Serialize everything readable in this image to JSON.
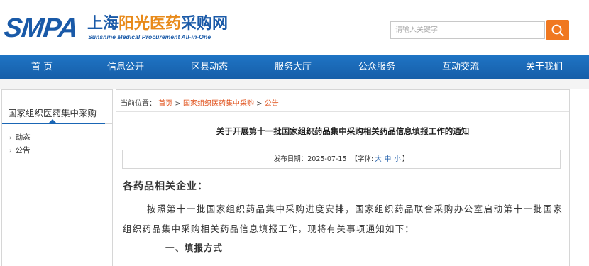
{
  "header": {
    "logo_text": "SMPA",
    "logo_cn_part1": "上海",
    "logo_cn_part2": "阳光医药",
    "logo_cn_part3": "采购网",
    "logo_en": "Sunshine Medical Procurement All-in-One",
    "search_placeholder": "请输入关键字",
    "search_icon": "search-icon",
    "accent_color": "#f07820",
    "brand_color": "#1a5aa8"
  },
  "nav": {
    "items": [
      "首 页",
      "信息公开",
      "区县动态",
      "服务大厅",
      "公众服务",
      "互动交流",
      "关于我们"
    ]
  },
  "sidebar": {
    "title": "国家组织医药集中采购",
    "items": [
      "动态",
      "公告"
    ]
  },
  "breadcrumb": {
    "prefix": "当前位置：",
    "items": [
      "首页",
      "国家组织医药集中采购",
      "公告"
    ],
    "separator": ">"
  },
  "article": {
    "title": "关于开展第十一批国家组织药品集中采购相关药品信息填报工作的通知",
    "date_label": "发布日期：",
    "date": "2025-07-15",
    "font_label": "【字体:",
    "font_large": "大",
    "font_medium": "中",
    "font_small": "小",
    "font_close": "】",
    "salutation": "各药品相关企业：",
    "paragraph": "按照第十一批国家组织药品集中采购进度安排，国家组织药品联合采购办公室启动第十一批国家组织药品集中采购相关药品信息填报工作，现将有关事项通知如下：",
    "partial_heading": "一、填报方式"
  }
}
